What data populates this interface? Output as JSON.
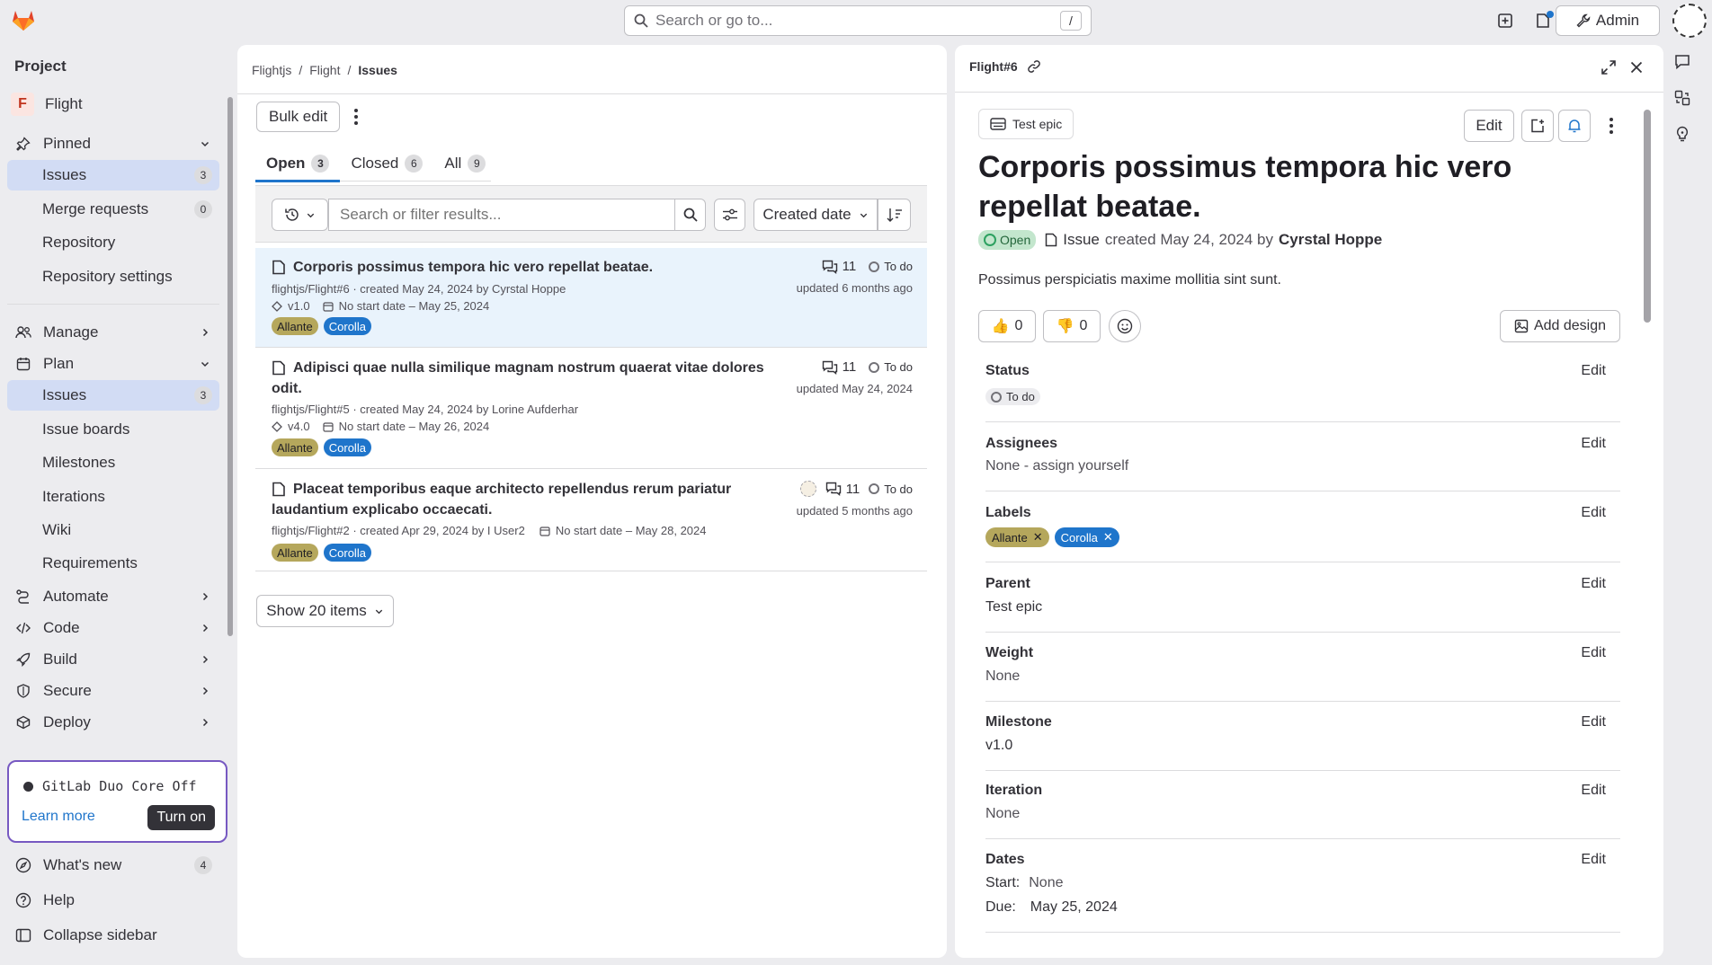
{
  "topbar": {
    "search_placeholder": "Search or go to...",
    "search_shortcut": "/",
    "admin_label": "Admin",
    "icons": [
      "plus-square-icon",
      "issue-icon",
      "merge-request-icon",
      "todo-icon"
    ]
  },
  "sidebar": {
    "section_title": "Project",
    "project": {
      "initial": "F",
      "name": "Flight"
    },
    "pinned": {
      "label": "Pinned"
    },
    "pinned_items": [
      {
        "label": "Issues",
        "badge": "3"
      },
      {
        "label": "Merge requests",
        "badge": "0"
      },
      {
        "label": "Repository"
      },
      {
        "label": "Repository settings"
      }
    ],
    "manage": "Manage",
    "plan": "Plan",
    "plan_items": [
      {
        "label": "Issues",
        "badge": "3"
      },
      {
        "label": "Issue boards"
      },
      {
        "label": "Milestones"
      },
      {
        "label": "Iterations"
      },
      {
        "label": "Wiki"
      },
      {
        "label": "Requirements"
      }
    ],
    "groups": [
      "Automate",
      "Code",
      "Build",
      "Secure",
      "Deploy"
    ],
    "duo": {
      "title": "GitLab Duo Core Off",
      "learn_more": "Learn more",
      "turn_on": "Turn on"
    },
    "footer": [
      {
        "label": "What's new",
        "badge": "4"
      },
      {
        "label": "Help"
      },
      {
        "label": "Collapse sidebar"
      }
    ]
  },
  "list": {
    "breadcrumb": [
      "Flightjs",
      "Flight",
      "Issues"
    ],
    "bulk_edit": "Bulk edit",
    "tabs": [
      {
        "label": "Open",
        "count": "3"
      },
      {
        "label": "Closed",
        "count": "6"
      },
      {
        "label": "All",
        "count": "9"
      }
    ],
    "filter_placeholder": "Search or filter results...",
    "sort_label": "Created date",
    "issues": [
      {
        "title": "Corporis possimus tempora hic vero repellat beatae.",
        "meta": "flightjs/Flight#6 · created May 24, 2024 by Cyrstal Hoppe",
        "milestone": "v1.0",
        "dates": "No start date – May 25, 2024",
        "labels": [
          "Allante",
          "Corolla"
        ],
        "comments": "11",
        "status": "To do",
        "updated": "updated 6 months ago"
      },
      {
        "title_line1": "Adipisci quae nulla similique magnam nostrum quaerat vitae dolores",
        "title_line2": "odit.",
        "meta": "flightjs/Flight#5 · created May 24, 2024 by Lorine Aufderhar",
        "milestone": "v4.0",
        "dates": "No start date – May 26, 2024",
        "labels": [
          "Allante",
          "Corolla"
        ],
        "comments": "11",
        "status": "To do",
        "updated": "updated May 24, 2024"
      },
      {
        "title_line1": "Placeat temporibus eaque architecto repellendus rerum pariatur",
        "title_line2": "laudantium explicabo occaecati.",
        "meta": "flightjs/Flight#2 · created Apr 29, 2024 by I User2",
        "dates": "No start date – May 28, 2024",
        "labels": [
          "Allante",
          "Corolla"
        ],
        "comments": "11",
        "status": "To do",
        "updated": "updated 5 months ago"
      }
    ],
    "show_items": "Show 20 items"
  },
  "detail": {
    "ref": "Flight#6",
    "epic": "Test epic",
    "edit": "Edit",
    "title": "Corporis possimus tempora hic vero repellat beatae.",
    "state": "Open",
    "type": "Issue",
    "created_text": "created May 24, 2024 by",
    "author": "Cyrstal Hoppe",
    "description": "Possimus perspiciatis maxime mollitia sint sunt.",
    "thumbs_up": "0",
    "thumbs_down": "0",
    "add_design": "Add design",
    "fields": {
      "status": {
        "title": "Status",
        "value": "To do"
      },
      "assignees": {
        "title": "Assignees",
        "value": "None - assign yourself"
      },
      "labels": {
        "title": "Labels",
        "values": [
          "Allante",
          "Corolla"
        ]
      },
      "parent": {
        "title": "Parent",
        "value": "Test epic"
      },
      "weight": {
        "title": "Weight",
        "value": "None"
      },
      "milestone": {
        "title": "Milestone",
        "value": "v1.0"
      },
      "iteration": {
        "title": "Iteration",
        "value": "None"
      },
      "dates": {
        "title": "Dates",
        "start_label": "Start:",
        "start": "None",
        "due_label": "Due:",
        "due": "May 25, 2024"
      }
    },
    "edit_label": "Edit"
  },
  "colors": {
    "accent": "#1f75cb",
    "active_nav": "#d2dcf4",
    "allante": "#b5a75c",
    "corolla": "#1f75cb",
    "duo_border": "#7759c2"
  }
}
